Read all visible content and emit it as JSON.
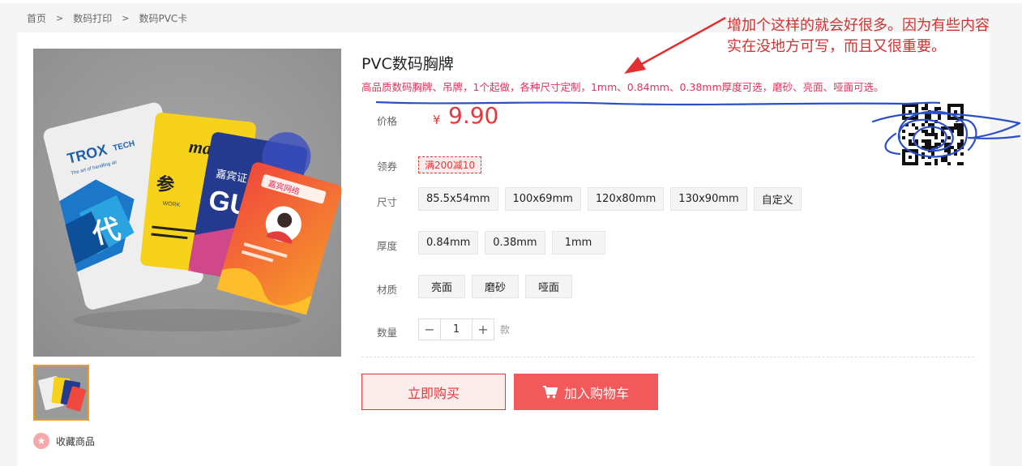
{
  "breadcrumb": {
    "items": [
      "首页",
      "数码打印",
      "数码PVC卡"
    ],
    "sep": ">"
  },
  "product": {
    "title": "PVC数码胸牌",
    "subtitle": "高品质数码胸牌、吊牌，1个起做，各种尺寸定制，1mm、0.84mm、0.38mm厚度可选，磨砂、亮面、哑面可选。",
    "price_label": "价格",
    "currency": "¥",
    "price": "9.90",
    "coupon_label": "领券",
    "coupon": "满200减10",
    "size_label": "尺寸",
    "sizes": [
      "85.5x54mm",
      "100x69mm",
      "120x80mm",
      "130x90mm",
      "自定义"
    ],
    "thickness_label": "厚度",
    "thicknesses": [
      "0.84mm",
      "0.38mm",
      "1mm"
    ],
    "material_label": "材质",
    "materials": [
      "亮面",
      "磨砂",
      "哑面"
    ],
    "qty_label": "数量",
    "qty_value": "1",
    "qty_unit": "款",
    "buy_now": "立即购买",
    "add_cart": "加入购物车",
    "favorite": "收藏商品"
  },
  "card_art": {
    "brand1": "TROX",
    "brand1_sub": "TECH",
    "brand1_tag": "The art of handling air",
    "big_char": "代",
    "card2_text": "参",
    "card2_sub": "WORK",
    "card3_text": "嘉宾证",
    "card3_big": "GU",
    "card4_text": "嘉宾网络"
  },
  "annotation": {
    "line1": "增加个这样的就会好很多。因为有些内容",
    "line2": "实在没地方可写，而且又很重要。"
  },
  "colors": {
    "accent": "#e4393c",
    "cart_bg": "#f1595a",
    "annotation_ink": "#cc3333",
    "scribble": "#2a4fc7"
  }
}
